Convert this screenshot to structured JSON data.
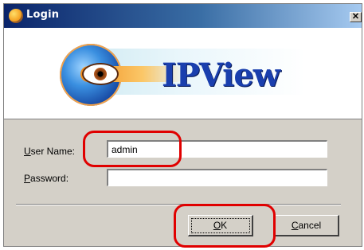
{
  "window": {
    "title": "Login",
    "close_glyph": "✕",
    "title_icon": "globe-eye-icon"
  },
  "banner": {
    "logo_text": "IPView"
  },
  "form": {
    "user_label_accel": "U",
    "user_label_rest": "ser Name:",
    "user_value": "admin",
    "password_label_accel": "P",
    "password_label_rest": "assword:",
    "password_value": ""
  },
  "buttons": {
    "ok_accel": "O",
    "ok_rest": "K",
    "cancel_accel": "C",
    "cancel_rest": "ancel"
  },
  "colors": {
    "dialog_face": "#d4d0c8",
    "titlebar_start": "#0a246a",
    "titlebar_end": "#a6caf0",
    "annotation": "#e00000",
    "logo_text": "#1a3fae"
  }
}
